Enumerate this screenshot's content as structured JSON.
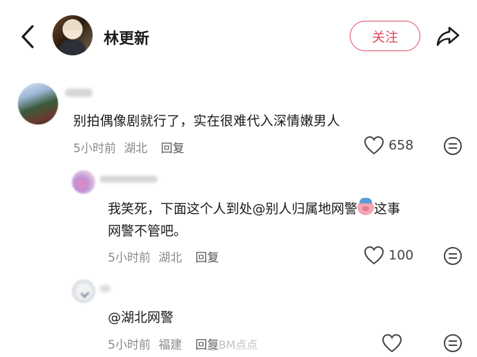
{
  "header": {
    "username": "林更新",
    "follow_label": "关注"
  },
  "comments": [
    {
      "text": "别拍偶像剧就行了，实在很难代入深情嫩男人",
      "time": "5小时前",
      "location": "湖北",
      "reply_label": "回复",
      "likes": "658"
    },
    {
      "text_part1": "我笑死，下面这个人到处@别人归属地网警",
      "text_part2": "这事",
      "text_line2": "网警不管吧。",
      "emoji": "piggy-emoji",
      "time": "5小时前",
      "location": "湖北",
      "reply_label": "回复",
      "likes": "100"
    },
    {
      "text": "@湖北网警",
      "time": "5小时前",
      "location": "福建",
      "reply_label": "回复"
    }
  ],
  "watermark": "@BM点点",
  "icons": [
    "back-icon",
    "share-icon",
    "heart-icon",
    "more-icon"
  ],
  "colors": {
    "accent": "#e0485f",
    "meta": "#8a8a8a"
  }
}
